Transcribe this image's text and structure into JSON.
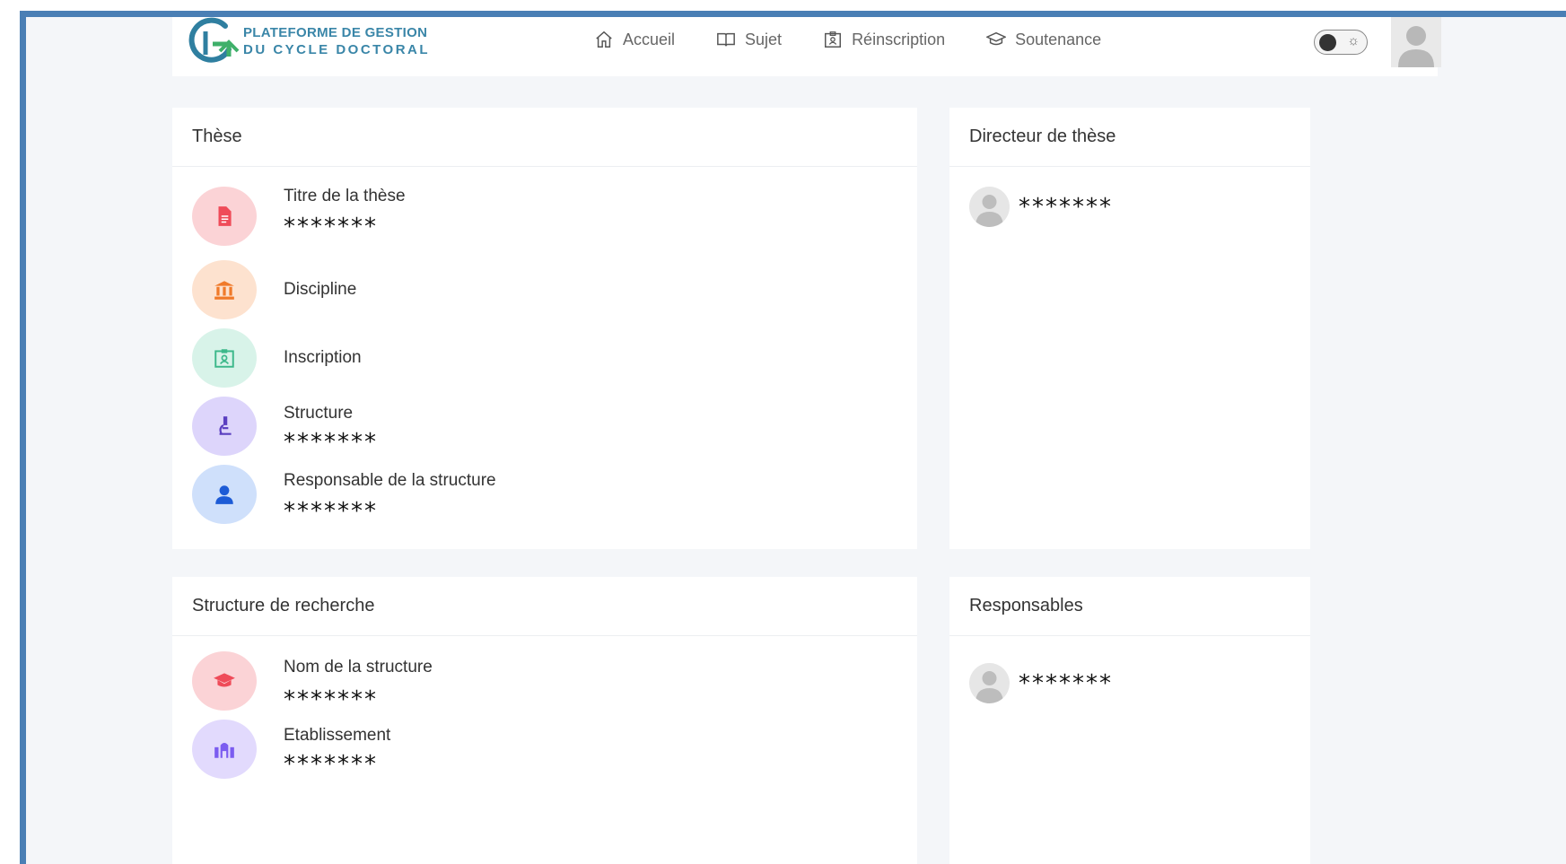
{
  "brand": {
    "line1": "PLATEFORME DE GESTION",
    "line2": "DU CYCLE DOCTORAL",
    "color": "#3a86a8"
  },
  "nav": {
    "items": [
      {
        "label": "Accueil",
        "icon": "home-icon"
      },
      {
        "label": "Sujet",
        "icon": "book-icon"
      },
      {
        "label": "Réinscription",
        "icon": "id-card-icon"
      },
      {
        "label": "Soutenance",
        "icon": "graduation-cap-icon"
      }
    ],
    "theme_toggle": {
      "state": "dark",
      "icon": "sun-icon"
    },
    "avatar": "user-avatar-icon"
  },
  "these": {
    "title": "Thèse",
    "items": [
      {
        "label": "Titre de la thèse",
        "value": "*******",
        "icon": "document-icon",
        "color": "#ef4b59",
        "bg": "#fbd3d6"
      },
      {
        "label": "Discipline",
        "value": "",
        "icon": "institution-icon",
        "color": "#f07a2a",
        "bg": "#fde2cf"
      },
      {
        "label": "Inscription",
        "value": "",
        "icon": "id-card-icon",
        "color": "#3cb88a",
        "bg": "#d8f3e9"
      },
      {
        "label": "Structure",
        "value": "*******",
        "icon": "microscope-icon",
        "color": "#5a3fc0",
        "bg": "#ddd5fb"
      },
      {
        "label": "Responsable de la structure",
        "value": "*******",
        "icon": "user-icon",
        "color": "#1d5bd6",
        "bg": "#cfe0fb"
      }
    ]
  },
  "directeur": {
    "title": "Directeur de thèse",
    "name": "*******"
  },
  "structure_recherche": {
    "title": "Structure de recherche",
    "items": [
      {
        "label": "Nom de la structure",
        "value": "*******",
        "icon": "graduation-cap-icon",
        "color": "#ef4b59",
        "bg": "#fbd3d6"
      },
      {
        "label": "Etablissement",
        "value": "*******",
        "icon": "building-icon",
        "color": "#7b5cf0",
        "bg": "#e2dafd"
      }
    ]
  },
  "responsables": {
    "title": "Responsables",
    "name": "*******"
  }
}
